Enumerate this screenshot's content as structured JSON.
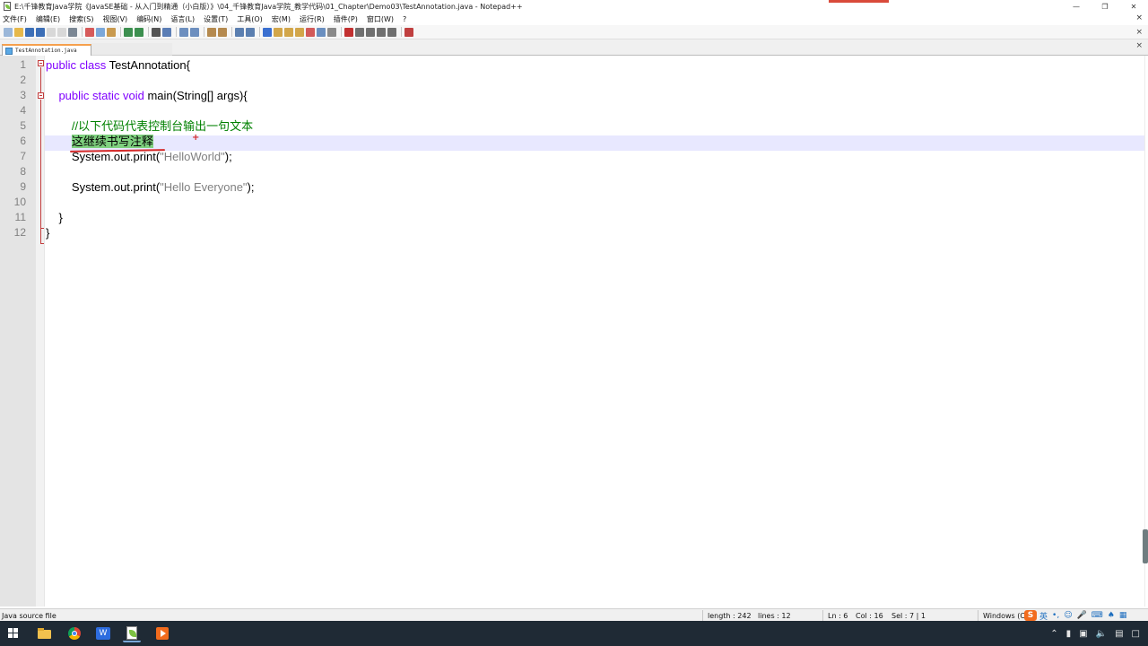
{
  "window": {
    "title": "E:\\千锋教育Java学院《JavaSE基础 - 从入门到精通（小白版）》\\04_千锋教育Java学院_教学代码\\01_Chapter\\Demo03\\TestAnnotation.java - Notepad++",
    "controls": [
      "minimize",
      "maximize",
      "close"
    ]
  },
  "menu": {
    "items": [
      "文件(F)",
      "编辑(E)",
      "搜索(S)",
      "视图(V)",
      "编码(N)",
      "语言(L)",
      "设置(T)",
      "工具(O)",
      "宏(M)",
      "运行(R)",
      "插件(P)",
      "窗口(W)",
      "?"
    ],
    "close_glyph": "×"
  },
  "toolbar": {
    "close_glyph": "×"
  },
  "tabs": [
    {
      "label": "TestAnnotation.java",
      "active": true
    }
  ],
  "tabbar": {
    "close_glyph": "×"
  },
  "editor": {
    "current_line": 6,
    "line_numbers": [
      "1",
      "2",
      "3",
      "4",
      "5",
      "6",
      "7",
      "8",
      "9",
      "10",
      "11",
      "12"
    ],
    "lines": [
      {
        "n": 1,
        "segments": [
          [
            "kw",
            "public class "
          ],
          [
            "plain",
            "TestAnnotation{"
          ]
        ]
      },
      {
        "n": 2,
        "segments": []
      },
      {
        "n": 3,
        "segments": [
          [
            "plain",
            "    "
          ],
          [
            "kw",
            "public static void "
          ],
          [
            "plain",
            "main(String[] args){"
          ]
        ]
      },
      {
        "n": 4,
        "segments": []
      },
      {
        "n": 5,
        "segments": [
          [
            "plain",
            "        "
          ],
          [
            "cmt",
            "//以下代码代表控制台输出一句文本"
          ]
        ]
      },
      {
        "n": 6,
        "segments": [
          [
            "plain",
            "        "
          ],
          [
            "sel",
            "这继续书写注释"
          ]
        ]
      },
      {
        "n": 7,
        "segments": [
          [
            "plain",
            "        System.out.print("
          ],
          [
            "str",
            "\"HelloWorld\""
          ],
          [
            "plain",
            ");"
          ]
        ]
      },
      {
        "n": 8,
        "segments": []
      },
      {
        "n": 9,
        "segments": [
          [
            "plain",
            "        System.out.print("
          ],
          [
            "str",
            "\"Hello Everyone\""
          ],
          [
            "plain",
            ");"
          ]
        ]
      },
      {
        "n": 10,
        "segments": []
      },
      {
        "n": 11,
        "segments": [
          [
            "plain",
            "    }"
          ]
        ]
      },
      {
        "n": 12,
        "segments": [
          [
            "plain",
            "}"
          ]
        ]
      }
    ]
  },
  "status": {
    "file_type": "Java source file",
    "length": "length : 242",
    "lines": "lines : 12",
    "ln": "Ln : 6",
    "col": "Col : 16",
    "sel": "Sel : 7 | 1",
    "eol": "Windows (CR",
    "ime_logo": "S",
    "ime_lang": "英"
  },
  "colors": {
    "keyword": "#8000ff",
    "comment": "#008000",
    "string": "#808080",
    "current_line": "#e8e8ff",
    "selection": "#7fd17f"
  }
}
